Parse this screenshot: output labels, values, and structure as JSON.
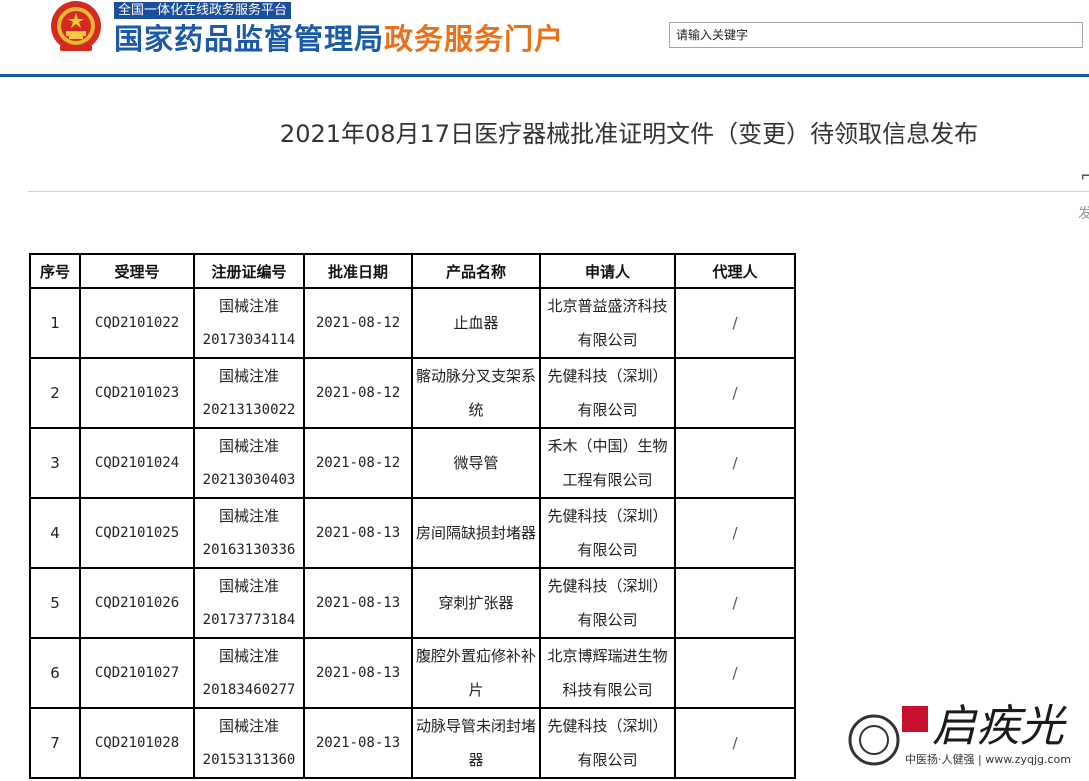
{
  "header": {
    "tagline": "全国一体化在线政务服务平台",
    "title_part1": "国家药品监督管理局",
    "title_part2": "政务服务门户",
    "search_placeholder": "请输入关键字",
    "brand_blue": "#1b5aa8",
    "brand_orange": "#e8711a"
  },
  "article": {
    "title": "2021年08月17日医疗器械批准证明文件（变更）待领取信息发布"
  },
  "table": {
    "headers": [
      "序号",
      "受理号",
      "注册证编号",
      "批准日期",
      "产品名称",
      "申请人",
      "代理人"
    ],
    "rows": [
      {
        "no": "1",
        "accept": "CQD2101022",
        "cert1": "国械注准",
        "cert2": "20173034114",
        "date": "2021-08-12",
        "product": "止血器",
        "applicant": "北京普益盛济科技有限公司",
        "agent": "/"
      },
      {
        "no": "2",
        "accept": "CQD2101023",
        "cert1": "国械注准",
        "cert2": "20213130022",
        "date": "2021-08-12",
        "product": "髂动脉分叉支架系统",
        "applicant": "先健科技（深圳）有限公司",
        "agent": "/"
      },
      {
        "no": "3",
        "accept": "CQD2101024",
        "cert1": "国械注准",
        "cert2": "20213030403",
        "date": "2021-08-12",
        "product": "微导管",
        "applicant": "禾木（中国）生物工程有限公司",
        "agent": "/"
      },
      {
        "no": "4",
        "accept": "CQD2101025",
        "cert1": "国械注准",
        "cert2": "20163130336",
        "date": "2021-08-13",
        "product": "房间隔缺损封堵器",
        "applicant": "先健科技（深圳）有限公司",
        "agent": "/"
      },
      {
        "no": "5",
        "accept": "CQD2101026",
        "cert1": "国械注准",
        "cert2": "20173773184",
        "date": "2021-08-13",
        "product": "穿刺扩张器",
        "applicant": "先健科技（深圳）有限公司",
        "agent": "/"
      },
      {
        "no": "6",
        "accept": "CQD2101027",
        "cert1": "国械注准",
        "cert2": "20183460277",
        "date": "2021-08-13",
        "product": "腹腔外置疝修补补片",
        "applicant": "北京博辉瑞进生物科技有限公司",
        "agent": "/"
      },
      {
        "no": "7",
        "accept": "CQD2101028",
        "cert1": "国械注准",
        "cert2": "20153131360",
        "date": "2021-08-13",
        "product": "动脉导管未闭封堵器",
        "applicant": "先健科技（深圳）有限公司",
        "agent": "/"
      }
    ]
  },
  "watermark": {
    "logo_text": "启疾光",
    "sub_text": "中医扬·人健强 | www.zyqjg.com"
  },
  "edge": {
    "glyph_top": "⌐",
    "glyph_bottom": "发"
  }
}
